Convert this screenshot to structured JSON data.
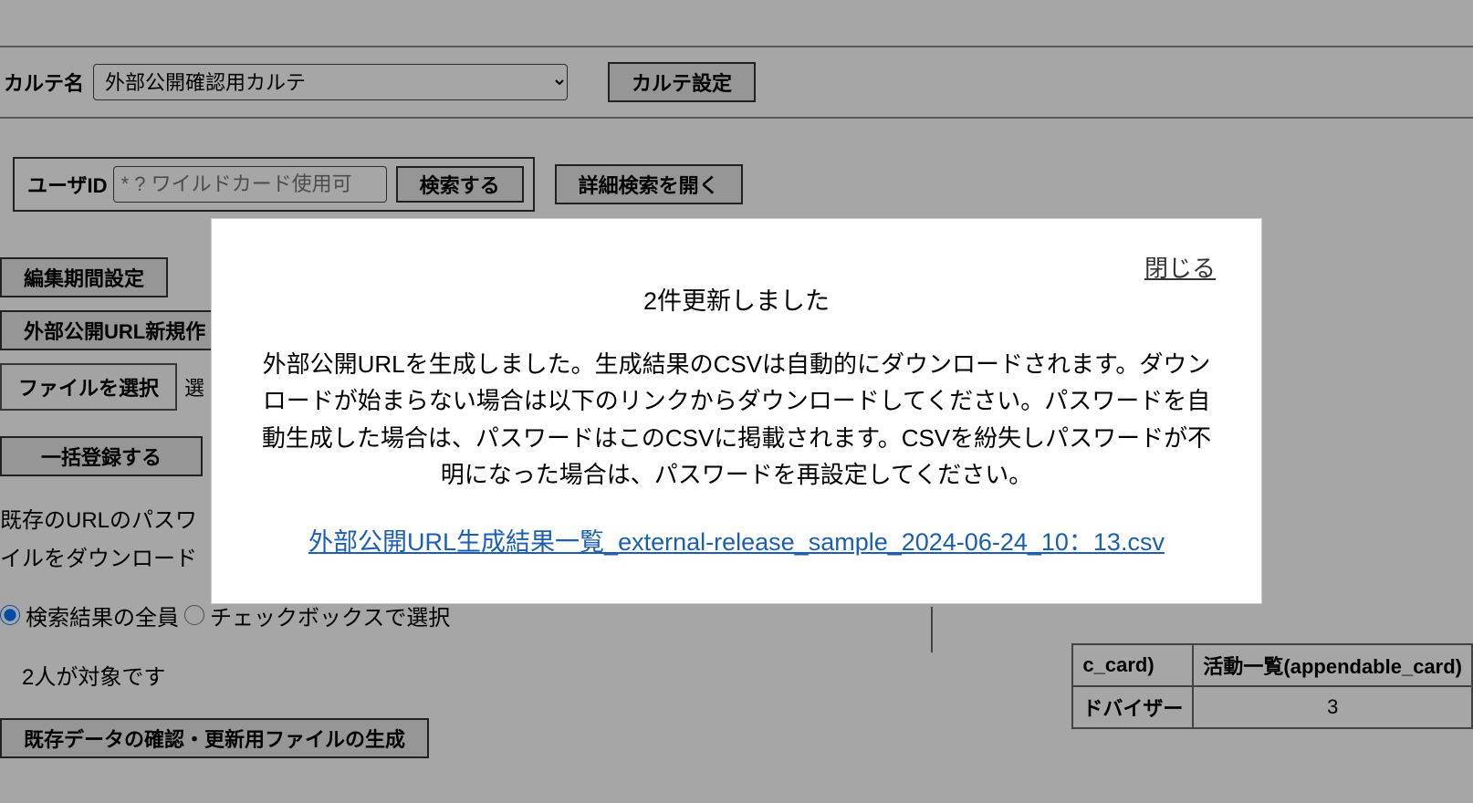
{
  "header": {
    "karte_label": "カルテ名",
    "karte_value": "外部公開確認用カルテ",
    "karte_settings_btn": "カルテ設定"
  },
  "search": {
    "userid_label": "ユーザID",
    "userid_placeholder": "* ? ワイルドカード使用可",
    "search_btn": "検索する",
    "advanced_btn": "詳細検索を開く"
  },
  "left_buttons": {
    "edit_period": "編集期間設定",
    "external_url_new": "外部公開URL新規作",
    "choose_file": "ファイルを選択",
    "choose_file_trail": "選",
    "bulk_register": "一括登録する"
  },
  "partial_text_1": "既存のURLのパスワ",
  "partial_text_2": "イルをダウンロード",
  "radio": {
    "opt_all": "検索結果の全員",
    "opt_checkbox": "チェックボックスで選択"
  },
  "count_text": "2人が対象です",
  "gen_file_btn": "既存データの確認・更新用ファイルの生成",
  "side_table": {
    "h1_partial": "c_card)",
    "h2": "活動一覧(appendable_card)",
    "c1_partial": "ドバイザー",
    "c2": "3"
  },
  "modal": {
    "close": "閉じる",
    "title": "2件更新しました",
    "body": "外部公開URLを生成しました。生成結果のCSVは自動的にダウンロードされます。ダウンロードが始まらない場合は以下のリンクからダウンロードしてください。パスワードを自動生成した場合は、パスワードはこのCSVに掲載されます。CSVを紛失しパスワードが不明になった場合は、パスワードを再設定してください。",
    "link": "外部公開URL生成結果一覧_external-release_sample_2024-06-24_10：13.csv"
  }
}
